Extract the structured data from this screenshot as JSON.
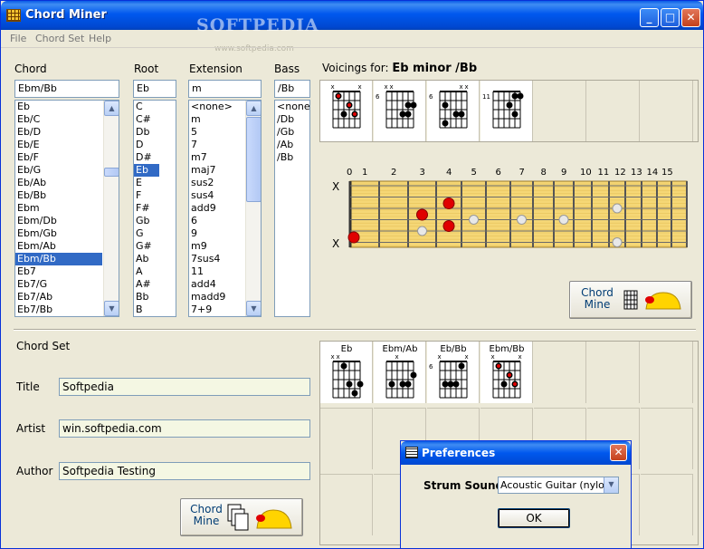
{
  "window": {
    "title": "Chord Miner",
    "watermark": "SOFTPEDIA",
    "watermark_sub": "www.softpedia.com"
  },
  "menu": [
    "File",
    "Chord Set",
    "Help"
  ],
  "labels": {
    "chord": "Chord",
    "root": "Root",
    "extension": "Extension",
    "bass": "Bass",
    "voicings_prefix": "Voicings for:",
    "voicings_chord": "Eb minor /Bb"
  },
  "chord": {
    "value": "Ebm/Bb",
    "items": [
      "Eb",
      "Eb/C",
      "Eb/D",
      "Eb/E",
      "Eb/F",
      "Eb/G",
      "Eb/Ab",
      "Eb/Bb",
      "Ebm",
      "Ebm/Db",
      "Ebm/Gb",
      "Ebm/Ab",
      "Ebm/Bb",
      "Eb7",
      "Eb7/G",
      "Eb7/Ab",
      "Eb7/Bb"
    ],
    "selected_index": 12
  },
  "root": {
    "value": "Eb",
    "items": [
      "C",
      "C#",
      "Db",
      "D",
      "D#",
      "Eb",
      "E",
      "F",
      "F#",
      "Gb",
      "G",
      "G#",
      "Ab",
      "A",
      "A#",
      "Bb",
      "B"
    ],
    "selected_index": 5
  },
  "extension": {
    "value": "m",
    "items": [
      "<none>",
      "m",
      "5",
      "7",
      "m7",
      "maj7",
      "sus2",
      "sus4",
      "add9",
      "6",
      "9",
      "m9",
      "7sus4",
      "11",
      "add4",
      "madd9",
      "7+9"
    ]
  },
  "bass": {
    "value": "/Bb",
    "items": [
      "<none>",
      "/Db",
      "/Gb",
      "/Ab",
      "/Bb"
    ]
  },
  "voicings": [
    {
      "fret": "",
      "dots": [
        [
          5,
          1,
          1
        ],
        [
          3,
          1,
          2
        ],
        [
          2,
          2,
          2
        ]
      ],
      "top": "x    x",
      "row_dots": [
        [
          1,
          1,
          true
        ],
        [
          4,
          2,
          true
        ],
        [
          2,
          3,
          true
        ],
        [
          4,
          3,
          true
        ]
      ]
    },
    {
      "fret": "6",
      "top": "xx  ",
      "row_dots": [
        [
          4,
          2,
          false
        ],
        [
          5,
          2,
          false
        ],
        [
          3,
          3,
          false
        ],
        [
          4,
          3,
          false
        ]
      ]
    },
    {
      "fret": "6",
      "top": "    xx",
      "row_dots": [
        [
          1,
          2,
          false
        ],
        [
          3,
          3,
          false
        ],
        [
          4,
          3,
          false
        ],
        [
          1,
          4,
          false
        ]
      ]
    },
    {
      "fret": "11",
      "top": "",
      "row_dots": [
        [
          4,
          1,
          false
        ],
        [
          5,
          1,
          false
        ],
        [
          3,
          2,
          false
        ],
        [
          4,
          3,
          false
        ]
      ]
    }
  ],
  "fretboard": {
    "fret_numbers": [
      "0",
      "1",
      "2",
      "3",
      "4",
      "5",
      "6",
      "7",
      "8",
      "9",
      "10",
      "11",
      "12",
      "13",
      "14",
      "15"
    ],
    "mutes": [
      "X",
      "X"
    ],
    "colors": {
      "wood": "#f5d776",
      "red_dot": "#e00000",
      "inlay": "#e8e8e8"
    }
  },
  "chord_miner_button": {
    "line1": "Chord",
    "line2": "Mine"
  },
  "chord_set": {
    "heading": "Chord Set",
    "title_label": "Title",
    "title_value": "Softpedia",
    "artist_label": "Artist",
    "artist_value": "win.softpedia.com",
    "author_label": "Author",
    "author_value": "Softpedia Testing",
    "chords": [
      {
        "name": "Eb",
        "fret": ""
      },
      {
        "name": "Ebm/Ab",
        "fret": ""
      },
      {
        "name": "Eb/Bb",
        "fret": "6"
      },
      {
        "name": "Ebm/Bb",
        "fret": ""
      }
    ]
  },
  "preferences": {
    "title": "Preferences",
    "strum_label": "Strum Sound",
    "strum_value": "Acoustic Guitar (nylon)",
    "ok_label": "OK"
  }
}
